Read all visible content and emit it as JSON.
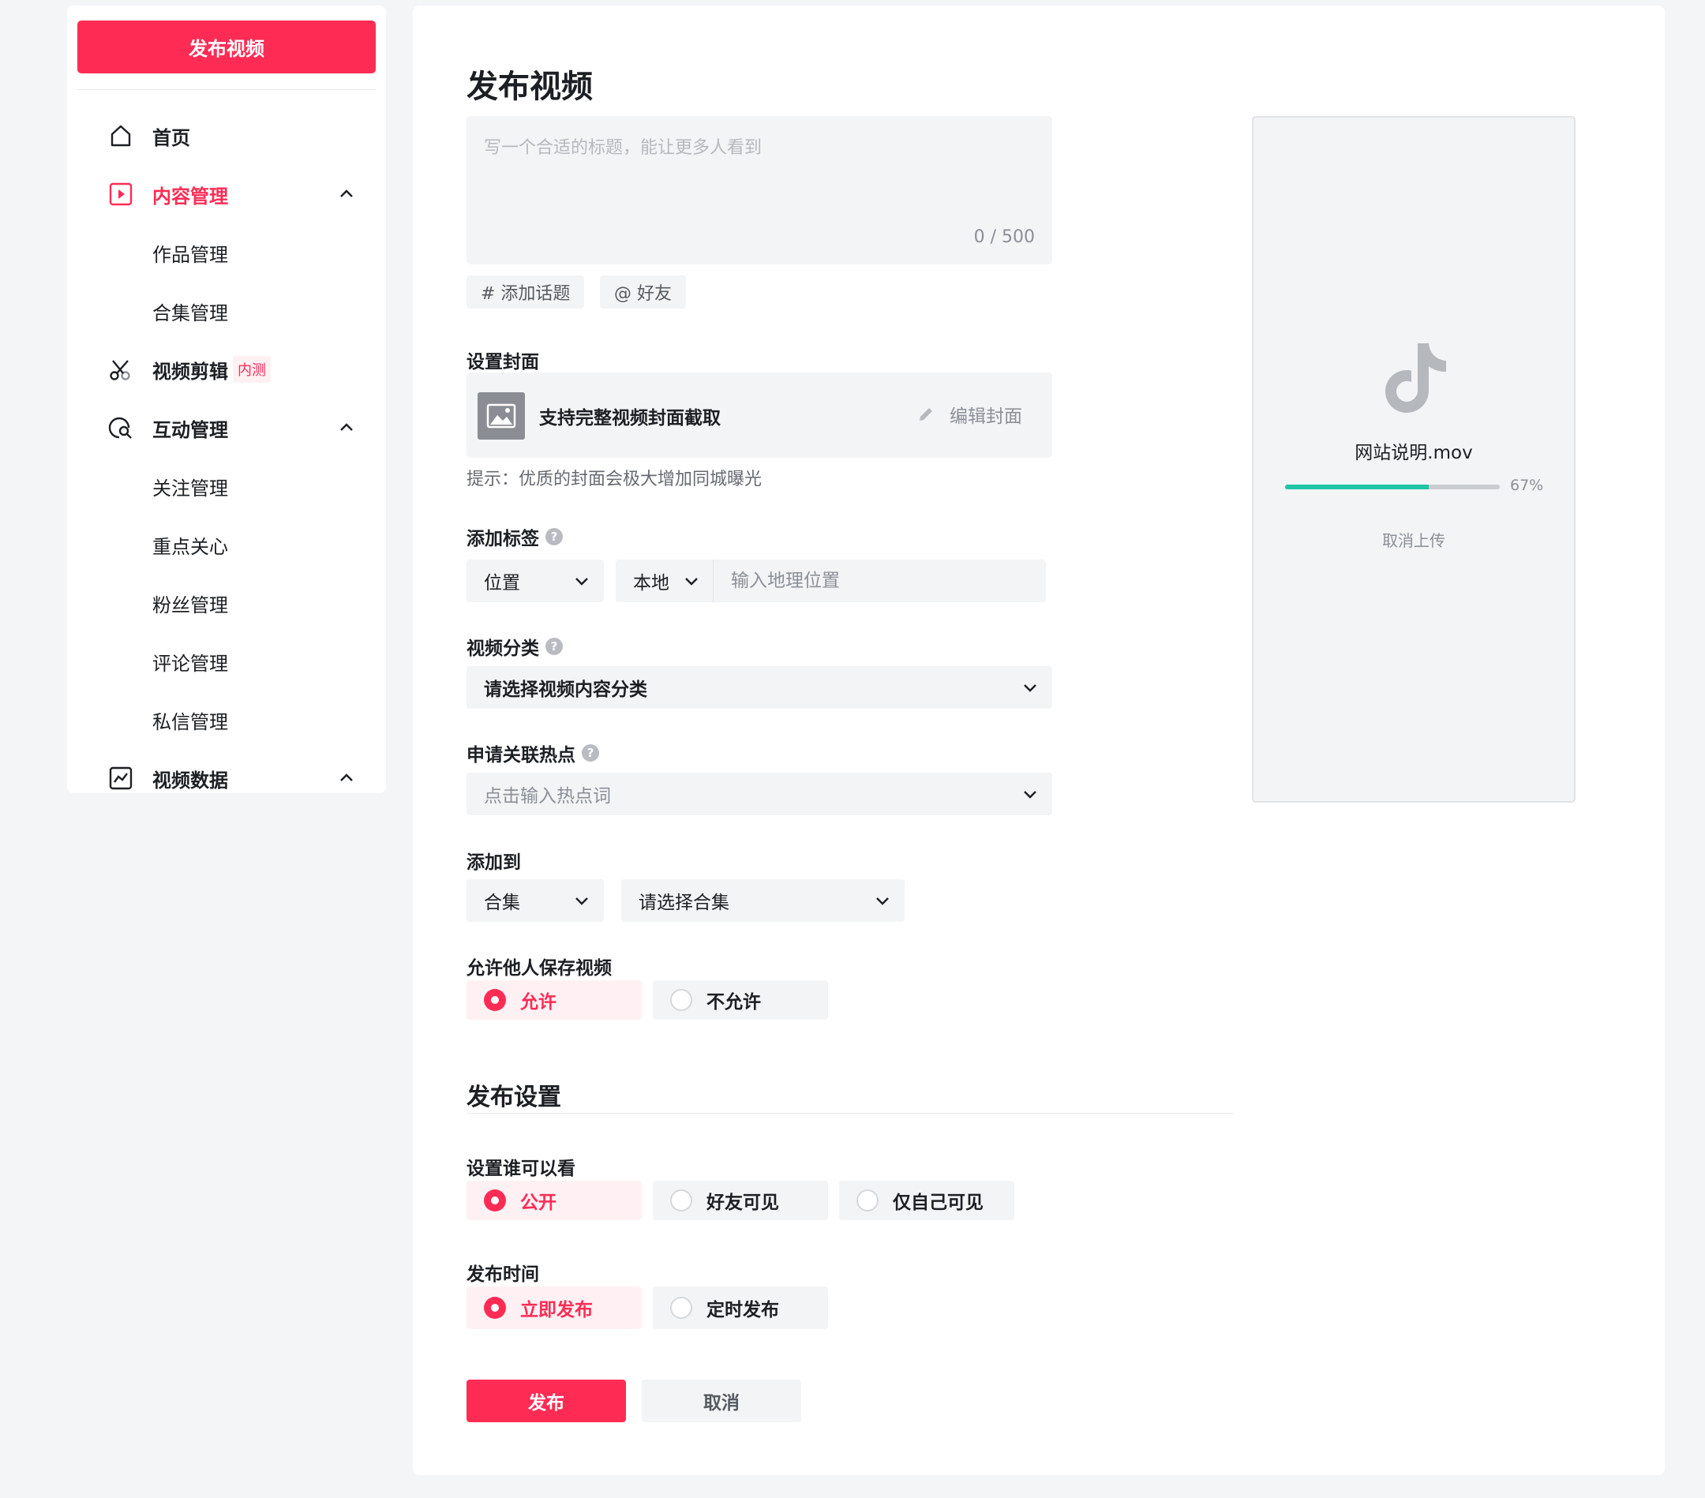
{
  "sidebar": {
    "publish_button": "发布视频",
    "items": [
      {
        "label": "首页"
      },
      {
        "label": "内容管理"
      },
      {
        "label": "作品管理"
      },
      {
        "label": "合集管理"
      },
      {
        "label": "视频剪辑",
        "badge": "内测"
      },
      {
        "label": "互动管理"
      },
      {
        "label": "关注管理"
      },
      {
        "label": "重点关心"
      },
      {
        "label": "粉丝管理"
      },
      {
        "label": "评论管理"
      },
      {
        "label": "私信管理"
      },
      {
        "label": "视频数据"
      }
    ]
  },
  "main": {
    "title": "发布视频",
    "title_input": {
      "placeholder": "写一个合适的标题，能让更多人看到",
      "value": "",
      "counter": "0 / 500"
    },
    "chips": [
      "# 添加话题",
      "@ 好友"
    ],
    "cover": {
      "label": "设置封面",
      "text": "支持完整视频封面截取",
      "edit": "编辑封面",
      "hint": "提示：优质的封面会极大增加同城曝光"
    },
    "tags": {
      "label": "添加标签",
      "type_select": "位置",
      "scope_select": "本地",
      "geo_placeholder": "输入地理位置"
    },
    "category": {
      "label": "视频分类",
      "select": "请选择视频内容分类"
    },
    "hotspot": {
      "label": "申请关联热点",
      "placeholder": "点击输入热点词"
    },
    "add_to": {
      "label": "添加到",
      "type_select": "合集",
      "collection_select": "请选择合集"
    },
    "allow_save": {
      "label": "允许他人保存视频",
      "options": [
        "允许",
        "不允许"
      ],
      "selected": "允许"
    },
    "publish_settings": {
      "title": "发布设置",
      "visibility": {
        "label": "设置谁可以看",
        "options": [
          "公开",
          "好友可见",
          "仅自己可见"
        ],
        "selected": "公开"
      },
      "time": {
        "label": "发布时间",
        "options": [
          "立即发布",
          "定时发布"
        ],
        "selected": "立即发布"
      }
    },
    "buttons": {
      "publish": "发布",
      "cancel": "取消"
    }
  },
  "preview": {
    "file_name": "网站说明.mov",
    "progress": 0.67,
    "progress_text": "67%",
    "cancel_upload": "取消上传"
  },
  "colors": {
    "accent": "#fe2c55",
    "progress": "#20c5a4",
    "field_bg": "#f3f4f5"
  }
}
